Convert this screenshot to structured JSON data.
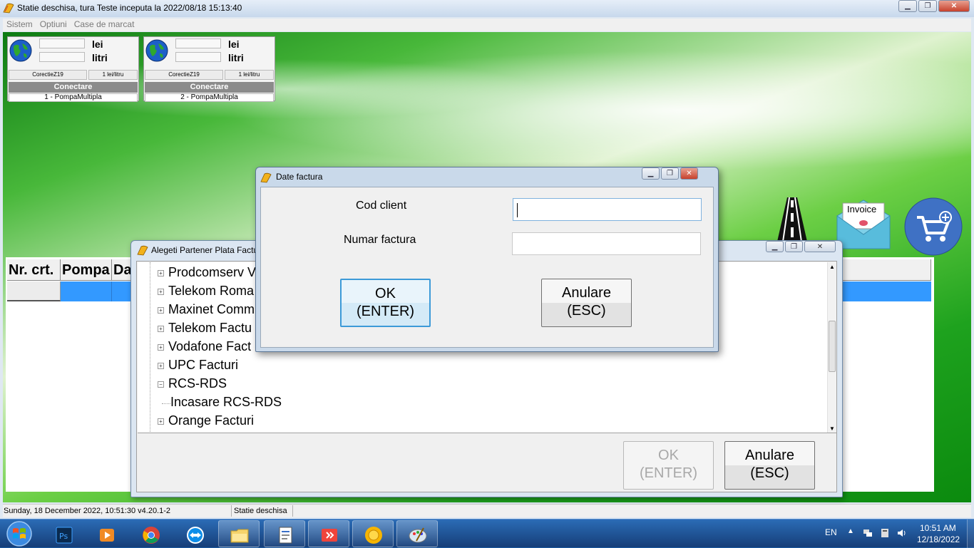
{
  "window": {
    "title": "Statie deschisa, tura Teste inceputa la 2022/08/18 15:13:40"
  },
  "menu": [
    "Sistem",
    "Optiuni",
    "Case de marcat"
  ],
  "pumps": [
    {
      "unit_money": "lei",
      "unit_volume": "litri",
      "correction": "CorectieZ19",
      "price_unit": "1 lei/litru",
      "connect_label": "Conectare",
      "name": "1 - PompaMultipla"
    },
    {
      "unit_money": "lei",
      "unit_volume": "litri",
      "correction": "CorectieZ19",
      "price_unit": "1 lei/litru",
      "connect_label": "Conectare",
      "name": "2 - PompaMultipla"
    }
  ],
  "desktop_icons": {
    "invoice_label": "Invoice"
  },
  "grid": {
    "columns": [
      "Nr. crt.",
      "Pompa",
      "Da"
    ]
  },
  "status_bar": {
    "datetime_version": "Sunday, 18 December 2022, 10:51:30 v4.20.1-2",
    "state": "Statie deschisa"
  },
  "partner_dialog": {
    "title": "Alegeti Partener Plata Factu",
    "tree": [
      {
        "label": "Prodcomserv V",
        "expander": "+",
        "level": 0
      },
      {
        "label": "Telekom Roma",
        "expander": "+",
        "level": 0
      },
      {
        "label": "Maxinet Comm",
        "expander": "+",
        "level": 0
      },
      {
        "label": "Telekom Factu",
        "expander": "+",
        "level": 0
      },
      {
        "label": "Vodafone Fact",
        "expander": "+",
        "level": 0
      },
      {
        "label": "UPC Facturi",
        "expander": "+",
        "level": 0
      },
      {
        "label": "RCS-RDS",
        "expander": "−",
        "level": 0
      },
      {
        "label": "Incasare RCS-RDS",
        "expander": "",
        "level": 1
      },
      {
        "label": "Orange Facturi",
        "expander": "+",
        "level": 0
      }
    ],
    "ok_line1": "OK",
    "ok_line2": "(ENTER)",
    "cancel_line1": "Anulare",
    "cancel_line2": "(ESC)"
  },
  "invoice_dialog": {
    "title": "Date factura",
    "client_code_label": "Cod client",
    "client_code_value": "",
    "invoice_number_label": "Numar factura",
    "invoice_number_value": "",
    "ok_line1": "OK",
    "ok_line2": "(ENTER)",
    "cancel_line1": "Anulare",
    "cancel_line2": "(ESC)"
  },
  "taskbar": {
    "apps": [
      "photoshop-icon",
      "media-player-icon",
      "chrome-icon",
      "teamviewer-icon",
      "file-explorer-icon",
      "document-app-icon",
      "anydesk-icon",
      "sun-app-icon",
      "paint-app-icon"
    ],
    "language": "EN",
    "time": "10:51 AM",
    "date": "12/18/2022"
  },
  "colors": {
    "selection_blue": "#3399ff",
    "focus_border": "#3c9ad8",
    "desktop_green": "#2aa628"
  }
}
